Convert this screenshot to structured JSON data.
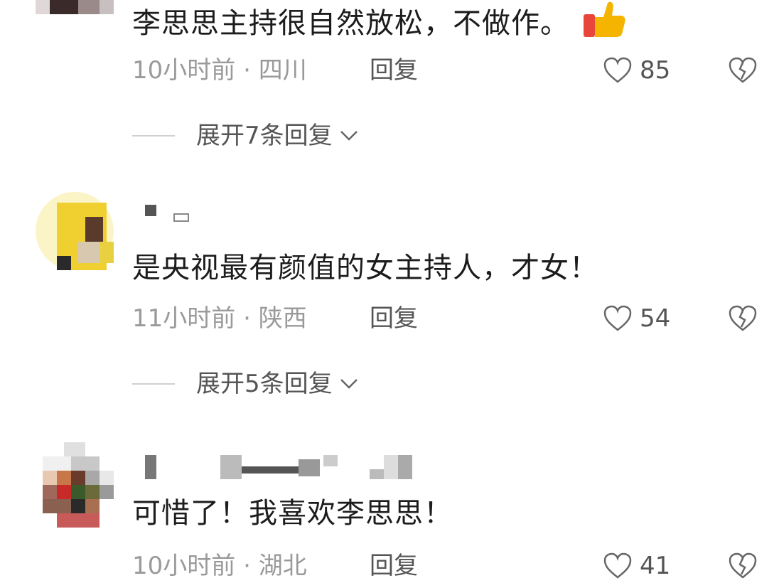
{
  "comments": [
    {
      "text": "李思思主持很自然放松，不做作。",
      "time": "10小时前",
      "location": "四川",
      "reply_label": "回复",
      "likes": "85",
      "expand_label": "展开7条回复"
    },
    {
      "text": "是央视最有颜值的女主持人，才女！",
      "time": "11小时前",
      "location": "陕西",
      "reply_label": "回复",
      "likes": "54",
      "expand_label": "展开5条回复"
    },
    {
      "text": "可惜了！我喜欢李思思！",
      "time": "10小时前",
      "location": "湖北",
      "reply_label": "回复",
      "likes": "41"
    }
  ],
  "separator": "·",
  "icons": {
    "like": "heart-outline-icon",
    "dislike": "broken-heart-icon",
    "expand": "chevron-down-icon",
    "emoji": "thumbs-up-emoji"
  },
  "colors": {
    "text": "#1c1c1c",
    "meta": "#9a9a9a",
    "action": "#555555",
    "emoji_yellow": "#f5b400",
    "emoji_red": "#e8463a"
  }
}
